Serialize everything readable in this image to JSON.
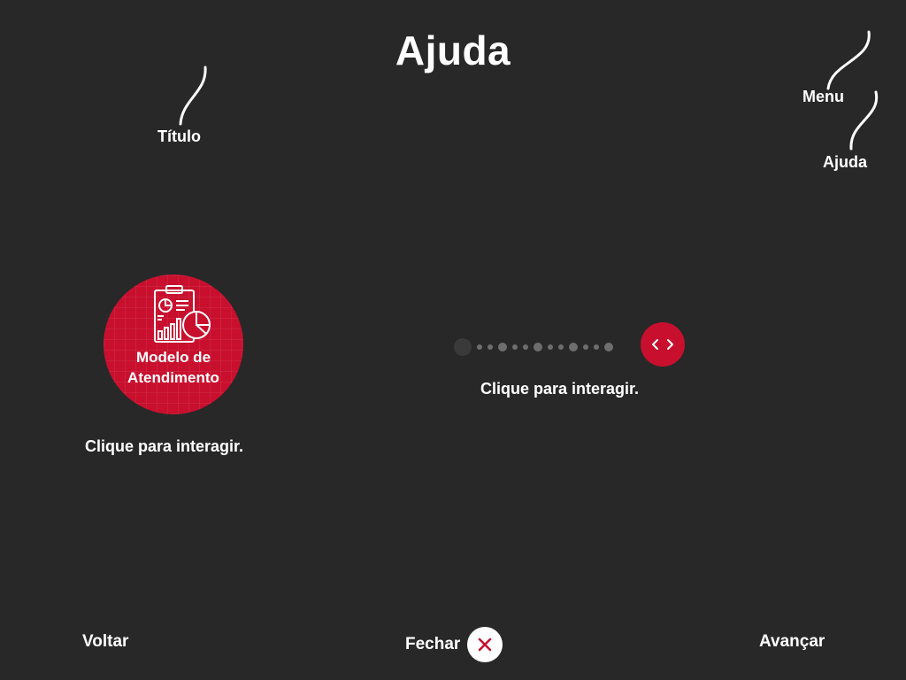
{
  "header": {
    "title": "Ajuda"
  },
  "callouts": {
    "titulo": "Título",
    "menu": "Menu",
    "ajuda": "Ajuda"
  },
  "module": {
    "icon": "clipboard-chart-icon",
    "label_line1": "Modelo de",
    "label_line2": "Atendimento",
    "hint": "Clique para interagir."
  },
  "pagination": {
    "dots": [
      "active",
      "small",
      "small",
      "medium",
      "small",
      "small",
      "medium",
      "small",
      "small",
      "medium",
      "small",
      "small",
      "medium"
    ],
    "nav_icon": "chevron-left-right-icon",
    "nav_label": "< >",
    "hint": "Clique para interagir."
  },
  "footer": {
    "back_label": "Voltar",
    "close_label": "Fechar",
    "close_icon": "close-icon",
    "next_label": "Avançar"
  },
  "colors": {
    "background": "#282828",
    "accent": "#c8102e",
    "text": "#ffffff"
  }
}
